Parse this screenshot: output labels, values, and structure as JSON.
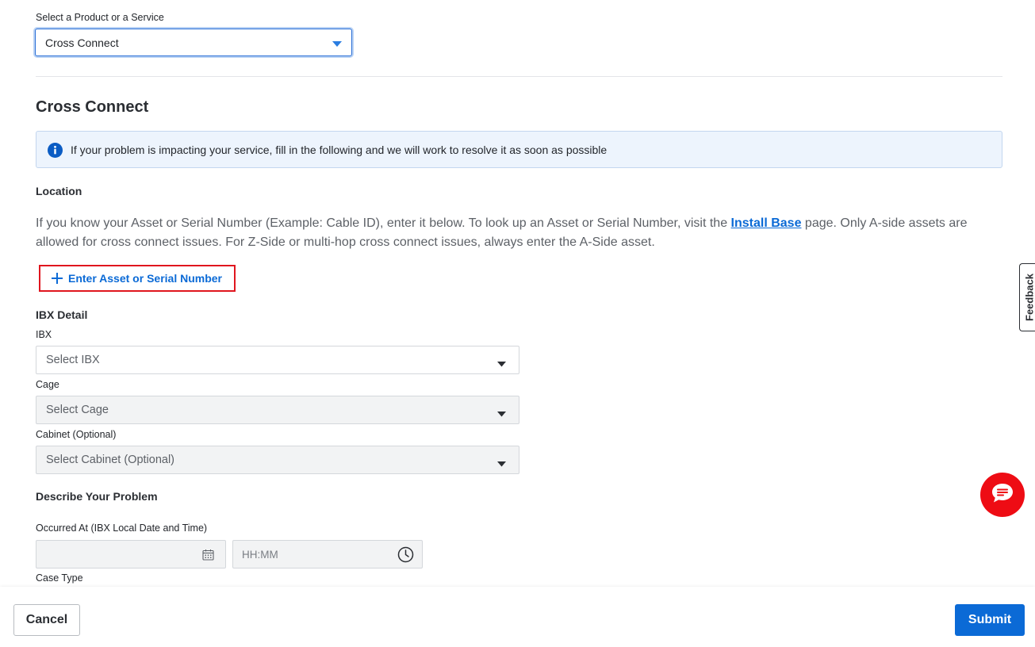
{
  "product": {
    "label": "Select a Product or a Service",
    "value": "Cross Connect"
  },
  "section": {
    "title": "Cross Connect",
    "info": "If your problem is impacting your service, fill in the following and we will work to resolve it as soon as possible"
  },
  "location": {
    "heading": "Location",
    "text_before_link": "If you know your Asset or Serial Number (Example: Cable ID), enter it below. To look up an Asset or Serial Number, visit the ",
    "link_text": "Install Base",
    "text_after_link": " page. Only A-side assets are allowed for cross connect issues. For Z-Side or multi-hop cross connect issues, always enter the A-Side asset.",
    "add_asset_label": "Enter Asset or Serial Number"
  },
  "ibx_detail": {
    "heading": "IBX Detail",
    "ibx_label": "IBX",
    "ibx_placeholder": "Select IBX",
    "cage_label": "Cage",
    "cage_placeholder": "Select Cage",
    "cabinet_label": "Cabinet (Optional)",
    "cabinet_placeholder": "Select Cabinet (Optional)"
  },
  "problem": {
    "heading": "Describe Your Problem",
    "occurred_label": "Occurred At (IBX Local Date and Time)",
    "date_value": "",
    "time_placeholder": "HH:MM",
    "case_type_label": "Case Type"
  },
  "footer": {
    "cancel_label": "Cancel",
    "submit_label": "Submit"
  },
  "feedback_label": "Feedback",
  "colors": {
    "accent": "#0b6ad6",
    "highlight_border": "#e0161e",
    "chat": "#ee0c14"
  }
}
